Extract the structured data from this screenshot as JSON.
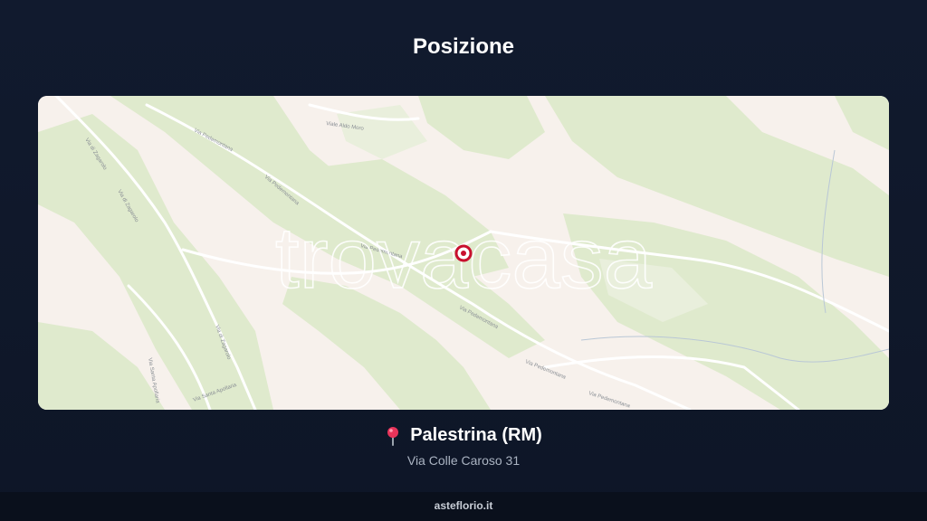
{
  "header": {
    "title": "Posizione"
  },
  "map": {
    "watermark": "trovacasa",
    "road_labels": {
      "zagarolo_1": "Via di Zagarolo",
      "zagarolo_2": "Via di Zagarolo",
      "zagarolo_3": "Via di Zagarolo",
      "pedemontana_1": "Via Pedemontana",
      "pedemontana_2": "Via Pedemontana",
      "pedemontana_3": "Via Pedemontana",
      "pedemontana_4": "Via Pedemontana",
      "pedemontana_5": "Via Pedemontana",
      "pedemontana_6": "Via Pedemontana",
      "aldo_moro": "Viale Aldo Moro",
      "santa_apollaria": "Via Santa Apollaria",
      "santa_apollaria_2": "Via Santa Apollaria"
    },
    "colors": {
      "land": "#f7f1ec",
      "park": "#dfeacd",
      "marker": "#c8102e"
    }
  },
  "location": {
    "city": "Palestrina (RM)",
    "address": "Via Colle Caroso 31",
    "icon": "map-pin-icon"
  },
  "footer": {
    "site": "asteflorio.it"
  }
}
